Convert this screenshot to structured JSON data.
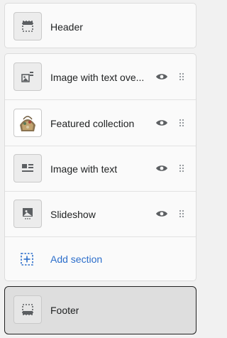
{
  "header": {
    "label": "Header",
    "icon": "header-layout-icon"
  },
  "sections": [
    {
      "label": "Image with text ove...",
      "icon": "image-with-text-overlay-icon"
    },
    {
      "label": "Featured collection",
      "icon": "product-thumbnail"
    },
    {
      "label": "Image with text",
      "icon": "image-with-text-icon"
    },
    {
      "label": "Slideshow",
      "icon": "slideshow-icon"
    }
  ],
  "add_section": {
    "label": "Add section",
    "icon": "add-section-icon"
  },
  "footer": {
    "label": "Footer",
    "icon": "footer-layout-icon"
  },
  "colors": {
    "link": "#2c6ecb",
    "icon": "#5c5f62",
    "text": "#202223"
  }
}
